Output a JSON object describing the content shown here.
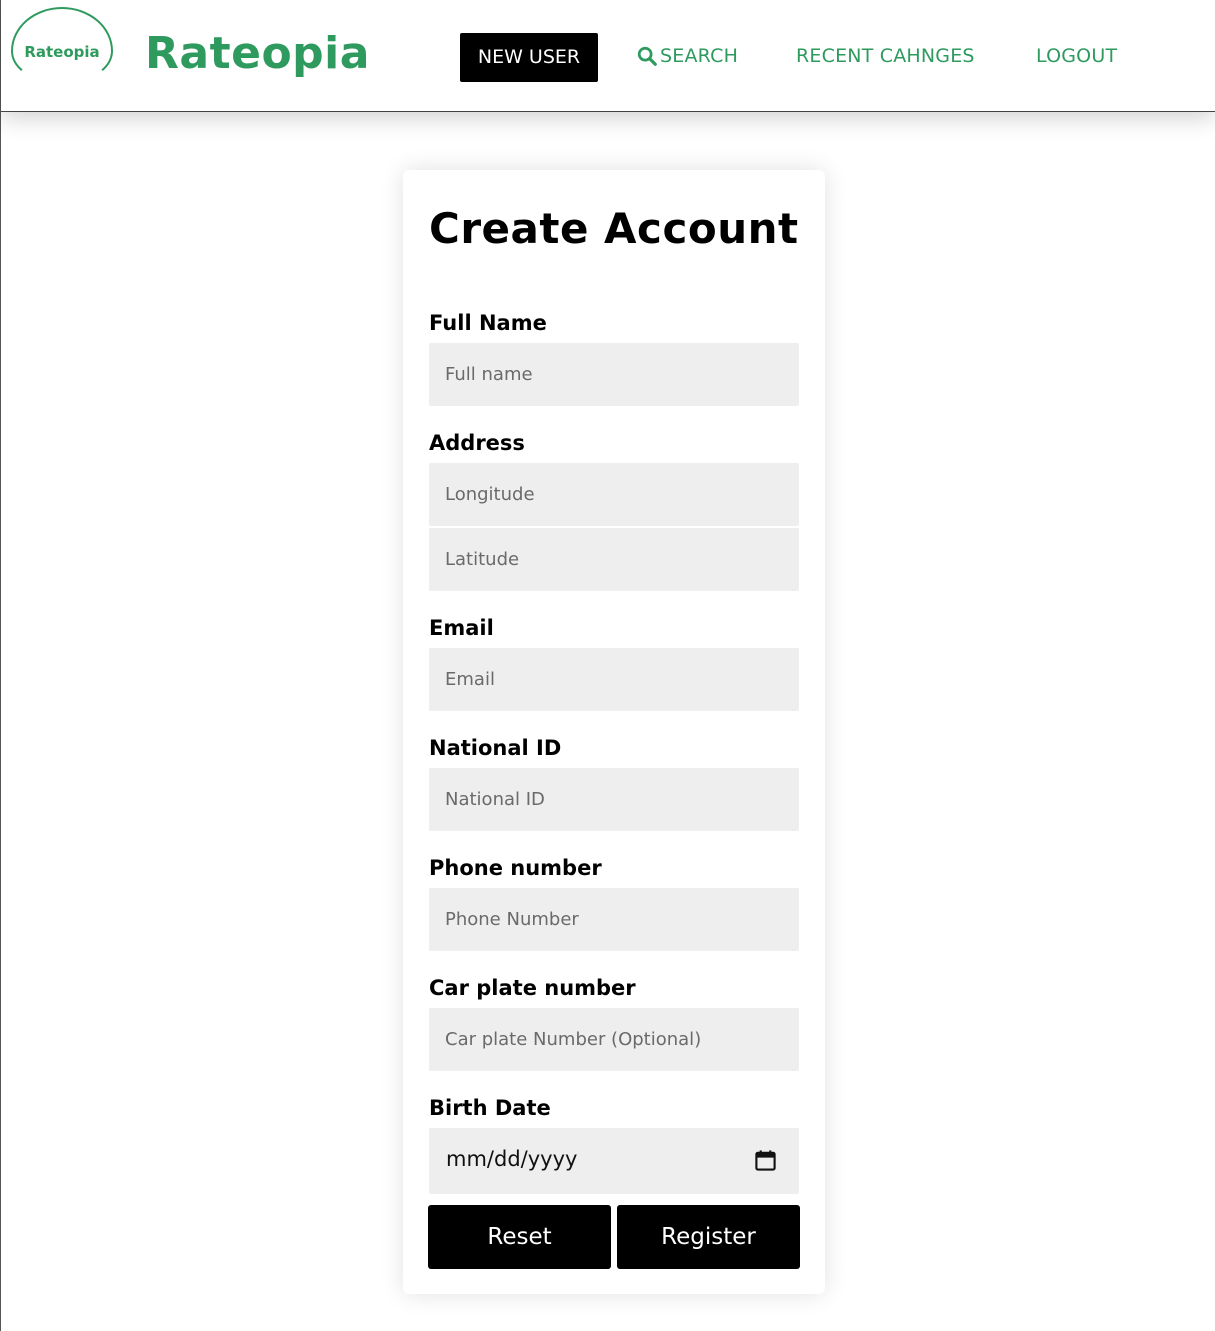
{
  "brand": {
    "badge_text": "Rateopia",
    "name": "Rateopia",
    "color": "#2e9a5e"
  },
  "nav": {
    "new_user": "NEW USER",
    "search": "SEARCH",
    "search_icon": "search-icon",
    "recent_changes": "RECENT CAHNGES",
    "logout": "LOGOUT"
  },
  "form": {
    "title": "Create Account",
    "full_name": {
      "label": "Full Name",
      "placeholder": "Full name"
    },
    "address": {
      "label": "Address",
      "longitude_placeholder": "Longitude",
      "latitude_placeholder": "Latitude"
    },
    "email": {
      "label": "Email",
      "placeholder": "Email"
    },
    "national_id": {
      "label": "National ID",
      "placeholder": "National ID"
    },
    "phone": {
      "label": "Phone number",
      "placeholder": "Phone Number"
    },
    "car_plate": {
      "label": "Car plate number",
      "placeholder": "Car plate Number (Optional)"
    },
    "birth_date": {
      "label": "Birth Date",
      "value": "mm/dd/yyyy",
      "icon": "calendar-icon"
    },
    "reset_label": "Reset",
    "register_label": "Register"
  }
}
